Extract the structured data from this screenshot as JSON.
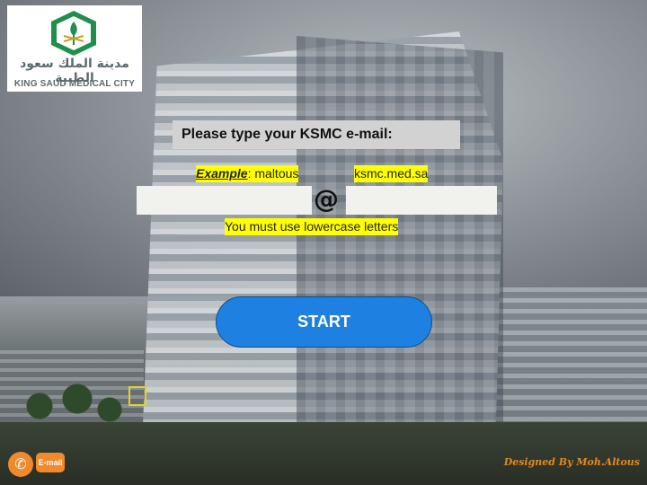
{
  "logo": {
    "arabic": "مدينة الملك سعود الطبية",
    "english": "KING SAUD MEDICAL CITY",
    "icon": "ksmc-emblem-icon"
  },
  "form": {
    "prompt": "Please type your KSMC e-mail:",
    "example_label": "Example",
    "example_value": ": maltous",
    "domain": "ksmc.med.sa",
    "at_symbol": "@",
    "username_value": "",
    "domain_value": "",
    "note": "You must use lowercase letters"
  },
  "start_label": "START",
  "footer": {
    "email_label": "E-mail",
    "call_icon": "phone-call-icon",
    "credit": "Designed By Moh.Altous"
  },
  "colors": {
    "button": "#1e80e0",
    "highlight": "#ffff00",
    "accent": "#f08a2c"
  }
}
